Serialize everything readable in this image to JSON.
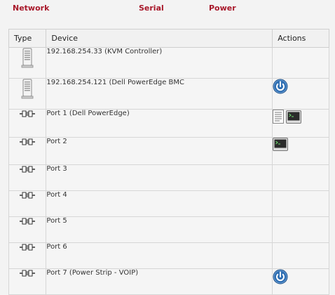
{
  "tabs": {
    "network": "Network",
    "serial": "Serial",
    "power": "Power"
  },
  "table": {
    "headers": {
      "type": "Type",
      "device": "Device",
      "actions": "Actions"
    },
    "rows": [
      {
        "type_icon": "server-icon",
        "device": "192.168.254.33 (KVM Controller)",
        "actions": []
      },
      {
        "type_icon": "server-icon",
        "device": "192.168.254.121 (Dell PowerEdge BMC",
        "actions": [
          "power-icon"
        ]
      },
      {
        "type_icon": "serial-plug-icon",
        "device": "Port 1 (Dell PowerEdge)",
        "actions": [
          "log-document-icon",
          "terminal-icon"
        ]
      },
      {
        "type_icon": "serial-plug-icon",
        "device": "Port 2",
        "actions": [
          "terminal-icon"
        ]
      },
      {
        "type_icon": "serial-plug-icon",
        "device": "Port 3",
        "actions": []
      },
      {
        "type_icon": "serial-plug-icon",
        "device": "Port 4",
        "actions": []
      },
      {
        "type_icon": "serial-plug-icon",
        "device": "Port 5",
        "actions": []
      },
      {
        "type_icon": "serial-plug-icon",
        "device": "Port 6",
        "actions": []
      },
      {
        "type_icon": "serial-plug-icon",
        "device": "Port 7 (Power Strip - VOIP)",
        "actions": [
          "power-icon"
        ]
      }
    ]
  },
  "colors": {
    "tab_text": "#a8182a",
    "power_icon": "#2f6fb3",
    "terminal_bg": "#2b2b2b",
    "terminal_text": "#6fe26f"
  }
}
